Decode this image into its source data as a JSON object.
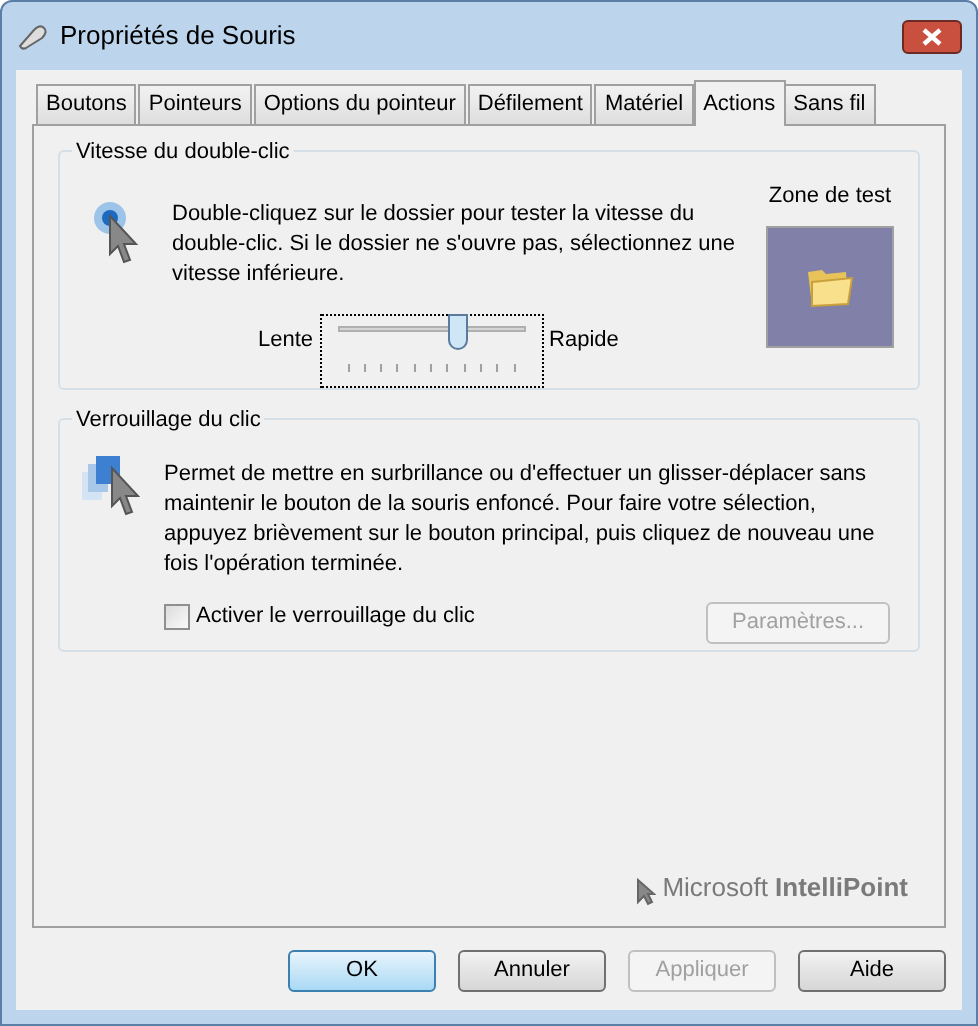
{
  "window": {
    "title": "Propriétés de Souris"
  },
  "tabs": [
    {
      "label": "Boutons",
      "selected": false
    },
    {
      "label": "Pointeurs",
      "selected": false
    },
    {
      "label": "Options du pointeur",
      "selected": false
    },
    {
      "label": "Défilement",
      "selected": false
    },
    {
      "label": "Matériel",
      "selected": false
    },
    {
      "label": "Actions",
      "selected": true
    },
    {
      "label": "Sans fil",
      "selected": false
    }
  ],
  "double_click": {
    "title": "Vitesse du double-clic",
    "description": "Double-cliquez sur le dossier pour tester la vitesse du double-clic. Si le dossier ne s'ouvre pas, sélectionnez une vitesse inférieure.",
    "slow_label": "Lente",
    "fast_label": "Rapide",
    "level": 0.7,
    "test_area_label": "Zone de test"
  },
  "click_lock": {
    "title": "Verrouillage du clic",
    "description": "Permet de mettre en surbrillance ou d'effectuer un glisser-déplacer sans maintenir le bouton de la souris enfoncé. Pour faire votre sélection, appuyez brièvement sur le bouton principal, puis cliquez de nouveau une fois l'opération terminée.",
    "checkbox": {
      "label": "Activer le verrouillage du clic",
      "checked": false
    },
    "settings_button": {
      "label": "Paramètres...",
      "disabled": true
    }
  },
  "branding": "Microsoft **IntelliPoint**",
  "buttons": [
    {
      "label": "OK",
      "disabled": false,
      "default": true
    },
    {
      "label": "Annuler",
      "disabled": false,
      "default": false
    },
    {
      "label": "Appliquer",
      "disabled": true,
      "default": false
    },
    {
      "label": "Aide",
      "disabled": false,
      "default": false
    }
  ]
}
